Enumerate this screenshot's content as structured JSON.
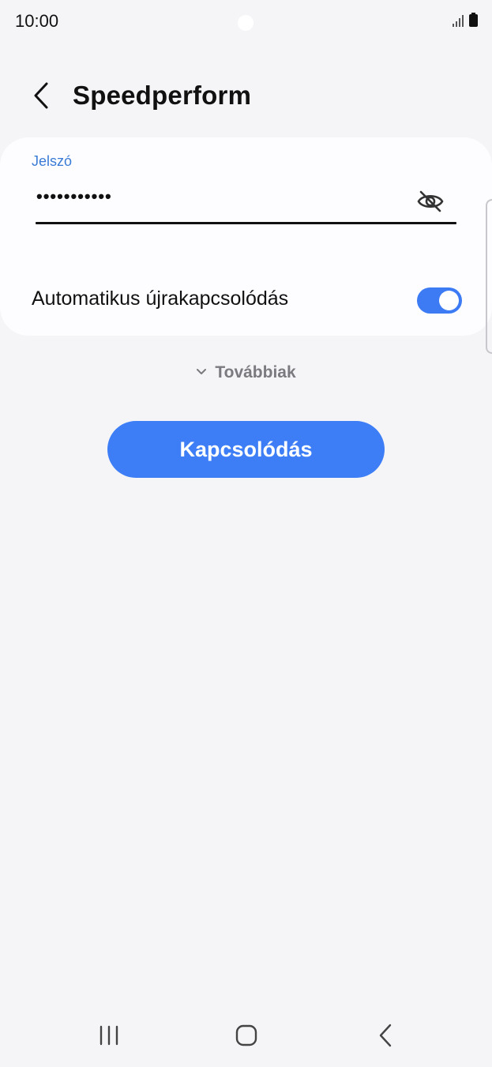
{
  "status_bar": {
    "time": "10:00",
    "icons": [
      "signal-icon",
      "battery-icon"
    ]
  },
  "header": {
    "back_icon": "chevron-left-icon",
    "title": "Speedperform"
  },
  "form": {
    "password_label": "Jelszó",
    "password_value": "•••••••••••",
    "visibility_icon": "eye-off-icon",
    "auto_reconnect_label": "Automatikus újrakapcsolódás",
    "auto_reconnect_on": true
  },
  "more": {
    "label": "Továbbiak",
    "icon": "chevron-down-icon"
  },
  "actions": {
    "connect_label": "Kapcsolódás"
  },
  "nav_bar": {
    "items": [
      "recents-icon",
      "home-icon",
      "back-icon"
    ]
  },
  "colors": {
    "accent": "#3d7ef7",
    "label_blue": "#3a7bd5",
    "background": "#f5f5f8",
    "card": "#fdfdff"
  }
}
